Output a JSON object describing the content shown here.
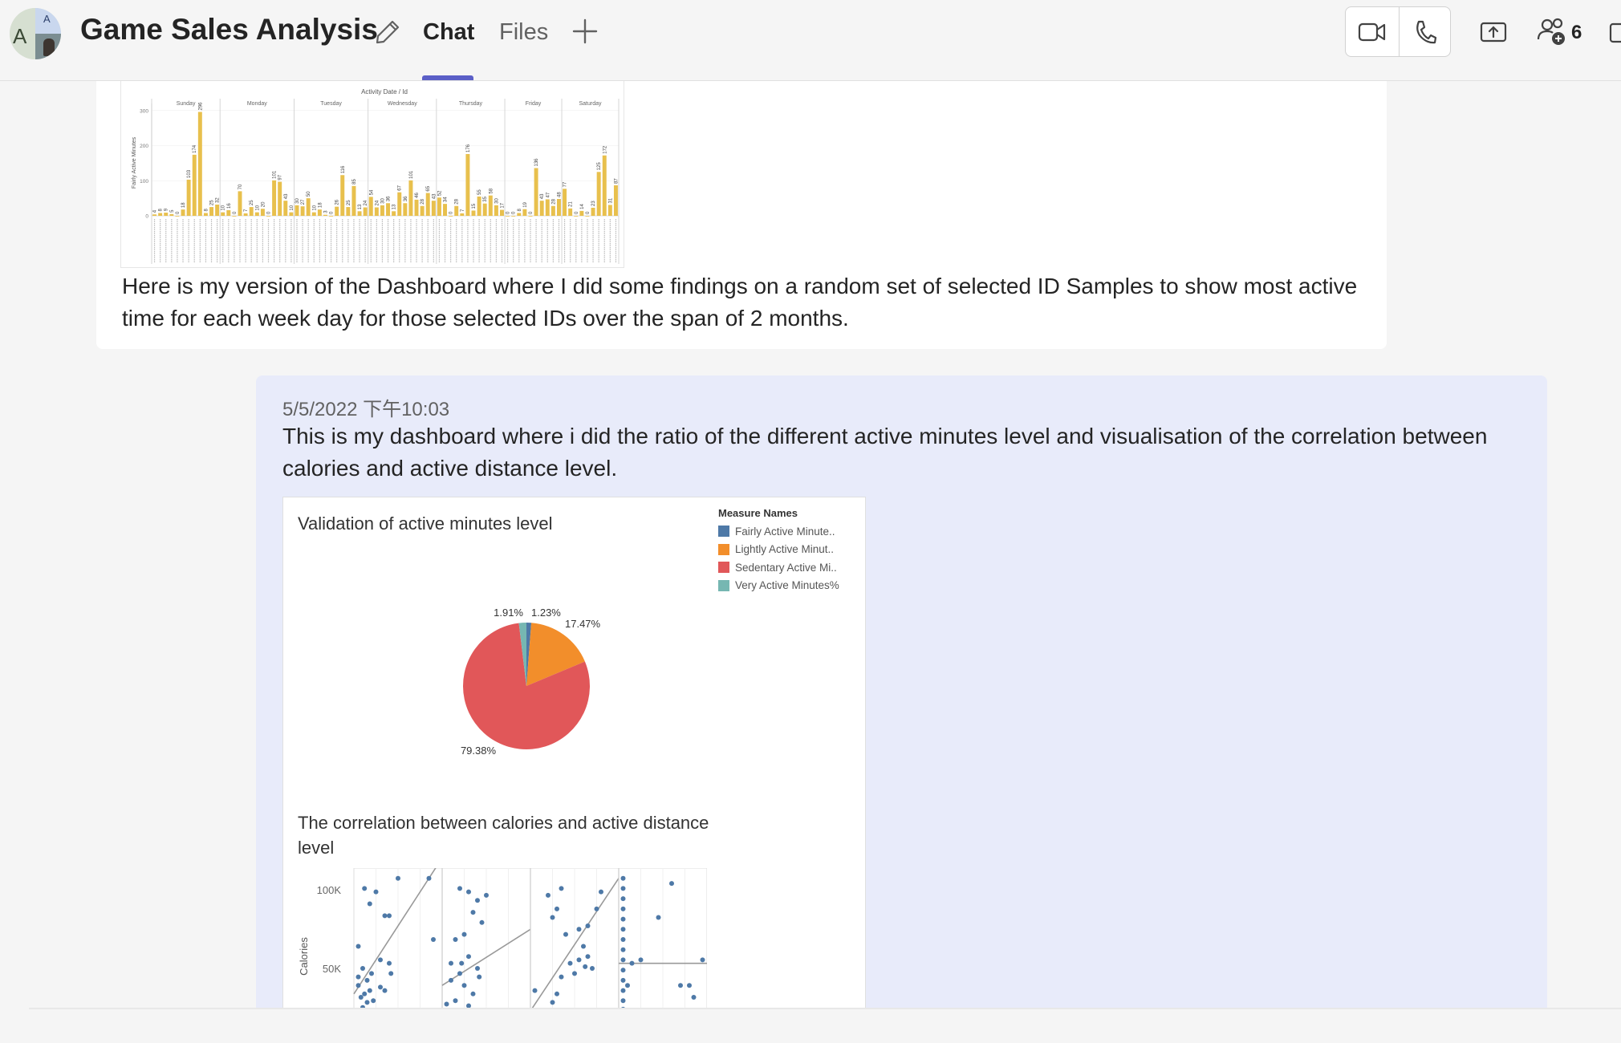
{
  "header": {
    "title": "Game Sales Analysis",
    "avatar_letter": "A",
    "avatar_small_letter": "A",
    "tabs": [
      {
        "label": "Chat",
        "active": true
      },
      {
        "label": "Files",
        "active": false
      }
    ],
    "people_count": "6",
    "accent_color": "#5b5fc7"
  },
  "messages": [
    {
      "text": "Here is my version of the Dashboard where I did some findings on a random set of selected ID Samples to show most active time for each week day for those selected IDs over the span of 2 months.",
      "attachment": {
        "chart_title": "Activity Date / Id",
        "ylabel": "Fairly Active Minutes",
        "days": [
          "Sunday",
          "Monday",
          "Tuesday",
          "Wednesday",
          "Thursday",
          "Friday",
          "Saturday"
        ],
        "bar_color": "#e8c04d"
      }
    },
    {
      "timestamp": "5/5/2022 下午10:03",
      "text": "This is my dashboard where i did the ratio of the different active minutes level and visualisation of the correlation between calories and active distance level.",
      "bubble_color": "#e8ebfa",
      "dashboard": {
        "pie_title": "Validation of active minutes level",
        "legend_title": "Measure Names",
        "legend": [
          {
            "label": "Fairly Active Minute..",
            "color": "#4e79a7"
          },
          {
            "label": "Lightly Active Minut..",
            "color": "#f28e2b"
          },
          {
            "label": "Sedentary Active Mi..",
            "color": "#e15759"
          },
          {
            "label": "Very Active Minutes%",
            "color": "#76b7b2"
          }
        ],
        "scatter_title": "The correlation between calories and active distance level",
        "scatter_ylabel": "Calories",
        "scatter_ticks": [
          "100K",
          "50K"
        ],
        "point_color": "#4e79a7"
      }
    }
  ],
  "chart_data": [
    {
      "type": "bar",
      "title": "Activity Date / Id",
      "ylabel": "Fairly Active Minutes",
      "ylim": [
        0,
        320
      ],
      "yticks": [
        0,
        100,
        200,
        300
      ],
      "groups": [
        "Sunday",
        "Monday",
        "Tuesday",
        "Wednesday",
        "Thursday",
        "Friday",
        "Saturday"
      ],
      "series": [
        {
          "group": "Sunday",
          "values": [
            4,
            8,
            9,
            5,
            0,
            18,
            103,
            174,
            296,
            8,
            25,
            32
          ]
        },
        {
          "group": "Monday",
          "values": [
            10,
            16,
            0,
            70,
            7,
            25,
            10,
            20,
            0,
            101,
            97,
            43,
            10
          ]
        },
        {
          "group": "Tuesday",
          "values": [
            30,
            27,
            50,
            10,
            18,
            3,
            0,
            26,
            116,
            25,
            85,
            13,
            24
          ]
        },
        {
          "group": "Wednesday",
          "values": [
            54,
            24,
            30,
            36,
            13,
            67,
            36,
            101,
            46,
            28,
            65,
            43
          ]
        },
        {
          "group": "Thursday",
          "values": [
            52,
            34,
            0,
            28,
            7,
            176,
            15,
            55,
            35,
            58,
            30,
            17
          ]
        },
        {
          "group": "Friday",
          "values": [
            0,
            0,
            8,
            19,
            0,
            136,
            43,
            47,
            28,
            48
          ]
        },
        {
          "group": "Saturday",
          "values": [
            77,
            21,
            0,
            14,
            0,
            23,
            125,
            172,
            31,
            87
          ]
        }
      ]
    },
    {
      "type": "pie",
      "title": "Validation of active minutes level",
      "legend": "top-right",
      "slices": [
        {
          "label": "Fairly Active Minutes%",
          "value": 1.23,
          "display": "1.23%"
        },
        {
          "label": "Lightly Active Minutes%",
          "value": 17.47,
          "display": "17.47%"
        },
        {
          "label": "Sedentary Active Minutes%",
          "value": 79.38,
          "display": "79.38%"
        },
        {
          "label": "Very Active Minutes%",
          "value": 1.91,
          "display": "1.91%"
        }
      ]
    },
    {
      "type": "scatter",
      "title": "The correlation between calories and active distance level",
      "ylabel": "Calories",
      "yticks": [
        "100K",
        "50K"
      ],
      "ylim": [
        30000,
        114000
      ],
      "panels": [
        {
          "points": [
            [
              0.05,
              68
            ],
            [
              0.12,
              102
            ],
            [
              0.18,
              93
            ],
            [
              0.25,
              100
            ],
            [
              0.35,
              86
            ],
            [
              0.4,
              86
            ],
            [
              0.5,
              108
            ],
            [
              0.9,
              72
            ],
            [
              0.1,
              55
            ],
            [
              0.15,
              48
            ],
            [
              0.2,
              52
            ],
            [
              0.05,
              45
            ],
            [
              0.08,
              38
            ],
            [
              0.12,
              40
            ],
            [
              0.18,
              42
            ],
            [
              0.22,
              36
            ],
            [
              0.3,
              44
            ],
            [
              0.35,
              42
            ],
            [
              0.42,
              52
            ],
            [
              0.05,
              50
            ],
            [
              0.15,
              35
            ],
            [
              0.1,
              32
            ],
            [
              0.3,
              60
            ],
            [
              0.85,
              108
            ],
            [
              0.4,
              58
            ]
          ],
          "trend": [
            [
              0.0,
              40
            ],
            [
              0.95,
              116
            ]
          ]
        },
        {
          "points": [
            [
              0.1,
              58
            ],
            [
              0.2,
              102
            ],
            [
              0.3,
              100
            ],
            [
              0.4,
              95
            ],
            [
              0.35,
              88
            ],
            [
              0.45,
              82
            ],
            [
              0.25,
              75
            ],
            [
              0.15,
              72
            ],
            [
              0.3,
              62
            ],
            [
              0.4,
              55
            ],
            [
              0.2,
              52
            ],
            [
              0.1,
              48
            ],
            [
              0.25,
              45
            ],
            [
              0.35,
              40
            ],
            [
              0.15,
              36
            ],
            [
              0.05,
              34
            ],
            [
              0.3,
              33
            ],
            [
              0.42,
              50
            ],
            [
              0.5,
              98
            ],
            [
              0.22,
              58
            ]
          ],
          "trend": [
            [
              0.0,
              45
            ],
            [
              1.0,
              78
            ]
          ]
        },
        {
          "points": [
            [
              0.2,
              98
            ],
            [
              0.35,
              102
            ],
            [
              0.3,
              90
            ],
            [
              0.25,
              85
            ],
            [
              0.4,
              75
            ],
            [
              0.55,
              78
            ],
            [
              0.6,
              68
            ],
            [
              0.65,
              62
            ],
            [
              0.7,
              55
            ],
            [
              0.55,
              60
            ],
            [
              0.45,
              58
            ],
            [
              0.35,
              50
            ],
            [
              0.3,
              40
            ],
            [
              0.25,
              35
            ],
            [
              0.15,
              30
            ],
            [
              0.05,
              42
            ],
            [
              0.5,
              52
            ],
            [
              0.65,
              80
            ],
            [
              0.8,
              100
            ],
            [
              0.75,
              90
            ],
            [
              0.62,
              56
            ]
          ],
          "trend": [
            [
              0.0,
              30
            ],
            [
              1.0,
              108
            ]
          ]
        },
        {
          "points": [
            [
              0.05,
              108
            ],
            [
              0.05,
              102
            ],
            [
              0.05,
              96
            ],
            [
              0.05,
              90
            ],
            [
              0.05,
              84
            ],
            [
              0.05,
              78
            ],
            [
              0.05,
              72
            ],
            [
              0.05,
              66
            ],
            [
              0.05,
              60
            ],
            [
              0.05,
              54
            ],
            [
              0.05,
              48
            ],
            [
              0.05,
              42
            ],
            [
              0.05,
              36
            ],
            [
              0.05,
              31
            ],
            [
              0.1,
              45
            ],
            [
              0.15,
              58
            ],
            [
              0.45,
              85
            ],
            [
              0.6,
              105
            ],
            [
              0.7,
              45
            ],
            [
              0.8,
              45
            ],
            [
              0.85,
              38
            ],
            [
              0.95,
              60
            ],
            [
              0.25,
              60
            ]
          ],
          "trend": [
            [
              0.0,
              58
            ],
            [
              1.0,
              58
            ]
          ]
        }
      ]
    }
  ]
}
